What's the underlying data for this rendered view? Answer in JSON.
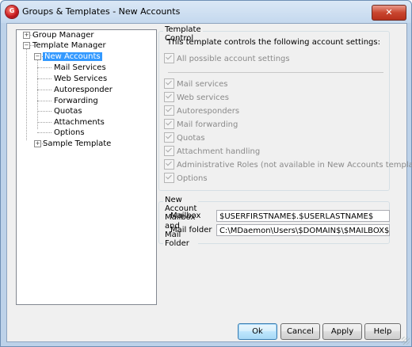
{
  "window": {
    "title": "Groups & Templates - New Accounts",
    "close_label": "✕",
    "icon_letter": "G"
  },
  "tree": {
    "items": [
      {
        "label": "Group Manager"
      },
      {
        "label": "Template Manager"
      },
      {
        "label": "New Accounts"
      },
      {
        "label": "Mail Services"
      },
      {
        "label": "Web Services"
      },
      {
        "label": "Autoresponder"
      },
      {
        "label": "Forwarding"
      },
      {
        "label": "Quotas"
      },
      {
        "label": "Attachments"
      },
      {
        "label": "Options"
      },
      {
        "label": "Sample Template"
      }
    ],
    "selected": "New Accounts"
  },
  "template_control": {
    "legend": "Template Control",
    "description": "This template controls the following account settings:",
    "all_settings": "All possible account settings",
    "options": [
      "Mail services",
      "Web services",
      "Autoresponders",
      "Mail forwarding",
      "Quotas",
      "Attachment handling",
      "Administrative Roles (not available in New Accounts template)",
      "Options"
    ]
  },
  "mailbox_group": {
    "legend": "New Account Mailbox and Mail Folder",
    "mailbox_label": "Mailbox",
    "mailbox_value": "$USERFIRSTNAME$.$USERLASTNAME$",
    "folder_label": "Mail folder",
    "folder_value": "C:\\MDaemon\\Users\\$DOMAIN$\\$MAILBOX$\\"
  },
  "buttons": {
    "ok": "Ok",
    "cancel": "Cancel",
    "apply": "Apply",
    "help": "Help"
  }
}
